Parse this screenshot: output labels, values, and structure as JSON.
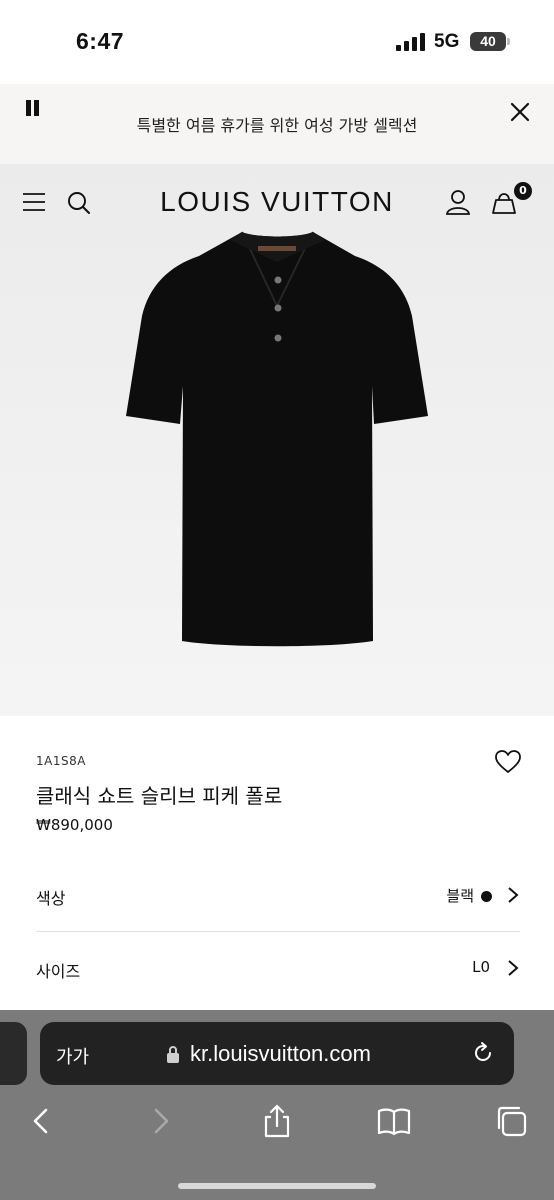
{
  "status_bar": {
    "time": "6:47",
    "network": "5G",
    "battery": "40"
  },
  "promo": {
    "text": "특별한 여름 휴가를 위한 여성 가방 셀렉션"
  },
  "header": {
    "brand": "LOUIS VUITTON",
    "bag_count": "0"
  },
  "product": {
    "sku": "1A1S8A",
    "name": "클래식 쇼트 슬리브 피케 폴로",
    "price": "₩890,000",
    "image_icon": "black-polo-shirt"
  },
  "options": {
    "color": {
      "label": "색상",
      "value": "블랙",
      "swatch_color": "#111111"
    },
    "size": {
      "label": "사이즈",
      "value": "L0"
    }
  },
  "browser": {
    "text_size_label": "가가",
    "url": "kr.louisvuitton.com"
  },
  "colors": {
    "banner_bg": "#f6f5f3",
    "hero_bg": "#eeeeee",
    "chrome_bg": "#7b7b7b"
  }
}
